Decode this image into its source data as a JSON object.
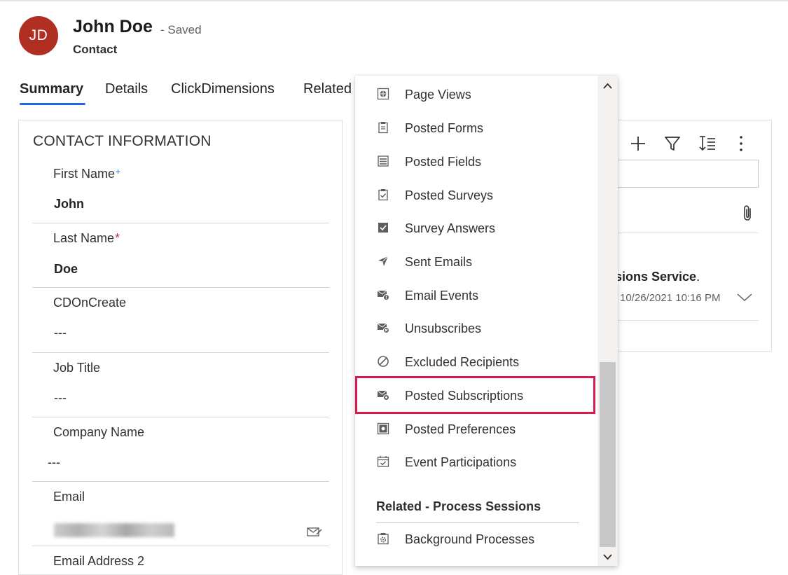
{
  "record": {
    "initials": "JD",
    "name": "John Doe",
    "status": "- Saved",
    "entity": "Contact",
    "avatar_color": "#b12e22"
  },
  "tabs": [
    {
      "label": "Summary",
      "active": true
    },
    {
      "label": "Details"
    },
    {
      "label": "ClickDimensions"
    },
    {
      "label": "Related"
    }
  ],
  "contact_info": {
    "title": "CONTACT INFORMATION",
    "fields": [
      {
        "label": "First Name",
        "value": "John",
        "required": "+"
      },
      {
        "label": "Last Name",
        "value": "Doe",
        "required": "*"
      },
      {
        "label": "CDOnCreate",
        "value": "---"
      },
      {
        "label": "Job Title",
        "value": "---"
      },
      {
        "label": "Company Name",
        "value": "---"
      },
      {
        "label": "Email"
      },
      {
        "label": "Email Address 2"
      }
    ]
  },
  "timeline": {
    "item_text": "sions Service",
    "item_punct": ".",
    "item_date": "10/26/2021 10:16 PM",
    "icons": [
      "add-icon",
      "filter-icon",
      "sort-icon",
      "more-icon",
      "paperclip-icon",
      "chevron-down-icon"
    ]
  },
  "related_menu": {
    "items": [
      {
        "label": "Page Views",
        "icon": "globe-page-icon"
      },
      {
        "label": "Posted Forms",
        "icon": "clipboard-icon"
      },
      {
        "label": "Posted Fields",
        "icon": "list-icon"
      },
      {
        "label": "Posted Surveys",
        "icon": "clipboard-check-icon"
      },
      {
        "label": "Survey Answers",
        "icon": "checkbox-icon"
      },
      {
        "label": "Sent Emails",
        "icon": "send-icon"
      },
      {
        "label": "Email Events",
        "icon": "email-alert-icon"
      },
      {
        "label": "Unsubscribes",
        "icon": "email-remove-icon"
      },
      {
        "label": "Excluded Recipients",
        "icon": "block-icon"
      },
      {
        "label": "Posted Subscriptions",
        "icon": "email-settings-icon"
      },
      {
        "label": "Posted Preferences",
        "icon": "preferences-icon"
      },
      {
        "label": "Event Participations",
        "icon": "calendar-check-icon"
      }
    ],
    "group_title": "Related - Process Sessions",
    "group_items": [
      {
        "label": "Background Processes",
        "icon": "process-settings-icon"
      }
    ],
    "highlight_color": "#d71a4f"
  }
}
